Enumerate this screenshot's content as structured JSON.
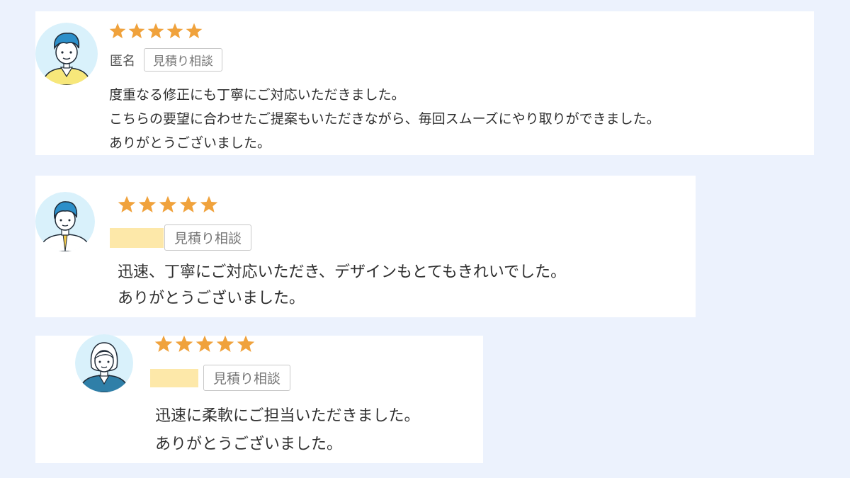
{
  "colors": {
    "background": "#ecf2fd",
    "card": "#ffffff",
    "star": "#f0a23c",
    "avatar_bg": "#d9f1fb",
    "name_mask": "#fde8a9",
    "tag_border": "#c8c8c8"
  },
  "reviews": [
    {
      "avatar_icon": "man-short-hair-avatar-icon",
      "rating": 5,
      "reviewer": "匿名",
      "tag": "見積り相談",
      "body": [
        "度重なる修正にも丁寧にご対応いただきました。",
        "こちらの要望に合わせたご提案もいただきながら、毎回スムーズにやり取りができました。",
        "ありがとうございました。"
      ]
    },
    {
      "avatar_icon": "man-tie-avatar-icon",
      "rating": 5,
      "reviewer": "",
      "tag": "見積り相談",
      "body": [
        "迅速、丁寧にご対応いただき、デザインもとてもきれいでした。",
        "ありがとうございました。"
      ]
    },
    {
      "avatar_icon": "woman-bob-hair-avatar-icon",
      "rating": 5,
      "reviewer": "",
      "tag": "見積り相談",
      "body": [
        "迅速に柔軟にご担当いただきました。",
        "ありがとうございました。"
      ]
    }
  ]
}
